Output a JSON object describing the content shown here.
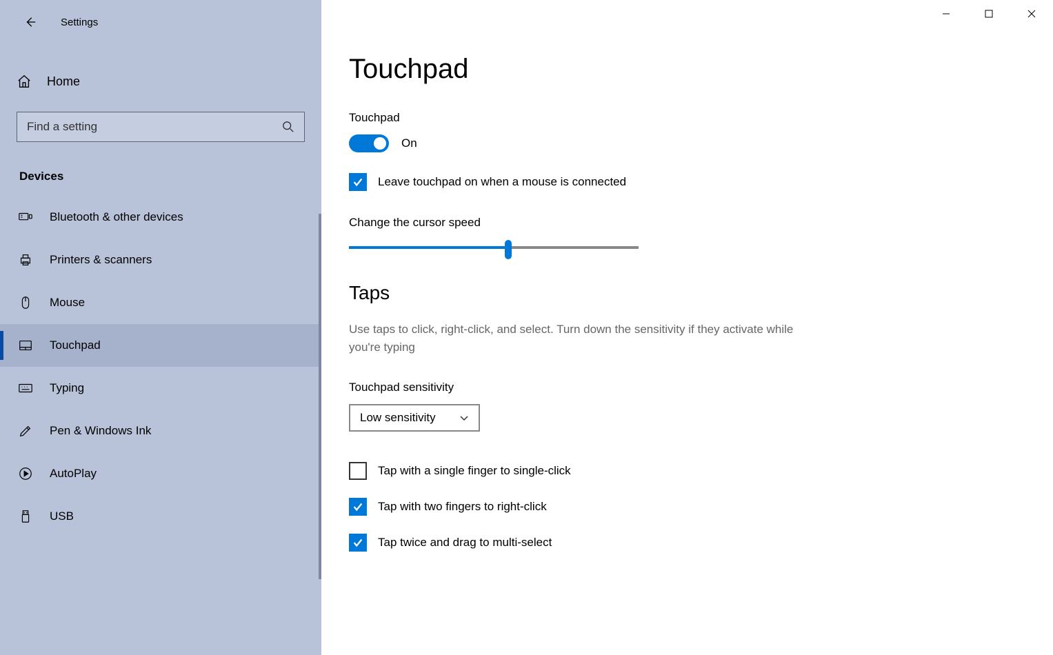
{
  "app_title": "Settings",
  "home_label": "Home",
  "search": {
    "placeholder": "Find a setting"
  },
  "section_label": "Devices",
  "nav": [
    {
      "label": "Bluetooth & other devices"
    },
    {
      "label": "Printers & scanners"
    },
    {
      "label": "Mouse"
    },
    {
      "label": "Touchpad"
    },
    {
      "label": "Typing"
    },
    {
      "label": "Pen & Windows Ink"
    },
    {
      "label": "AutoPlay"
    },
    {
      "label": "USB"
    }
  ],
  "page": {
    "title": "Touchpad",
    "touchpad_label": "Touchpad",
    "toggle_state": "On",
    "leave_mouse": "Leave touchpad on when a mouse is connected",
    "cursor_speed_label": "Change the cursor speed",
    "cursor_speed_percent": 55,
    "taps_heading": "Taps",
    "taps_desc": "Use taps to click, right-click, and select. Turn down the sensitivity if they activate while you're typing",
    "sensitivity_label": "Touchpad sensitivity",
    "sensitivity_value": "Low sensitivity",
    "tap_single": "Tap with a single finger to single-click",
    "tap_two": "Tap with two fingers to right-click",
    "tap_drag": "Tap twice and drag to multi-select"
  },
  "checkboxes": {
    "leave_mouse": true,
    "tap_single": false,
    "tap_two": true,
    "tap_drag": true
  },
  "colors": {
    "accent": "#0078d7",
    "sidebar": "#b8c2d8"
  }
}
